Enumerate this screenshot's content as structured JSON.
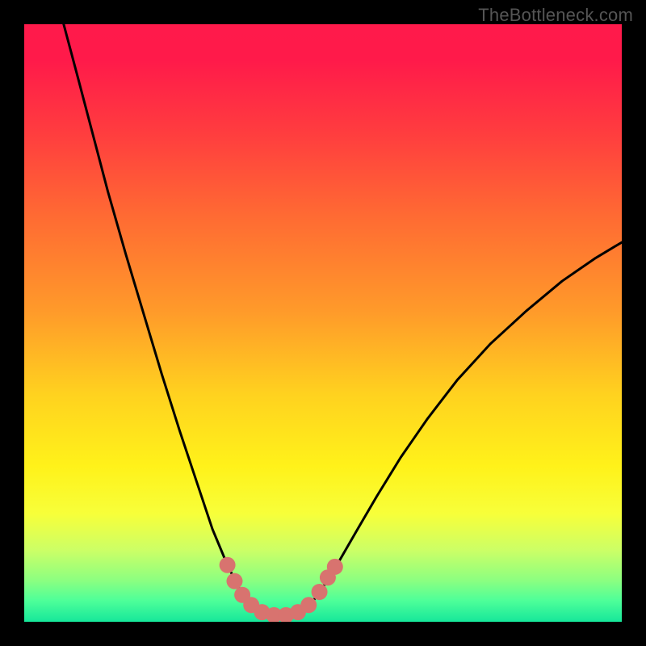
{
  "watermark": "TheBottleneck.com",
  "chart_data": {
    "type": "line",
    "title": "",
    "xlabel": "",
    "ylabel": "",
    "xlim": [
      0,
      1
    ],
    "ylim": [
      0,
      1
    ],
    "grid": false,
    "legend": false,
    "annotations": [],
    "background_gradient": {
      "stops": [
        {
          "offset": 0.0,
          "color": "#ff1a4b"
        },
        {
          "offset": 0.06,
          "color": "#ff1a4a"
        },
        {
          "offset": 0.18,
          "color": "#ff3c3f"
        },
        {
          "offset": 0.32,
          "color": "#ff6a33"
        },
        {
          "offset": 0.48,
          "color": "#ff9a2a"
        },
        {
          "offset": 0.62,
          "color": "#ffd21f"
        },
        {
          "offset": 0.74,
          "color": "#fff21a"
        },
        {
          "offset": 0.82,
          "color": "#f7ff3a"
        },
        {
          "offset": 0.88,
          "color": "#ccff66"
        },
        {
          "offset": 0.93,
          "color": "#8dff80"
        },
        {
          "offset": 0.965,
          "color": "#4dff99"
        },
        {
          "offset": 1.0,
          "color": "#16e79a"
        }
      ]
    },
    "series": [
      {
        "name": "bottleneck-curve",
        "stroke": "#000000",
        "stroke_width": 3,
        "points": [
          {
            "x": 0.066,
            "y": 1.0
          },
          {
            "x": 0.09,
            "y": 0.91
          },
          {
            "x": 0.115,
            "y": 0.815
          },
          {
            "x": 0.14,
            "y": 0.72
          },
          {
            "x": 0.17,
            "y": 0.615
          },
          {
            "x": 0.2,
            "y": 0.515
          },
          {
            "x": 0.23,
            "y": 0.415
          },
          {
            "x": 0.26,
            "y": 0.32
          },
          {
            "x": 0.29,
            "y": 0.23
          },
          {
            "x": 0.315,
            "y": 0.155
          },
          {
            "x": 0.34,
            "y": 0.095
          },
          {
            "x": 0.36,
            "y": 0.055
          },
          {
            "x": 0.38,
            "y": 0.028
          },
          {
            "x": 0.4,
            "y": 0.014
          },
          {
            "x": 0.42,
            "y": 0.01
          },
          {
            "x": 0.44,
            "y": 0.01
          },
          {
            "x": 0.46,
            "y": 0.014
          },
          {
            "x": 0.48,
            "y": 0.03
          },
          {
            "x": 0.5,
            "y": 0.058
          },
          {
            "x": 0.525,
            "y": 0.098
          },
          {
            "x": 0.555,
            "y": 0.15
          },
          {
            "x": 0.59,
            "y": 0.21
          },
          {
            "x": 0.63,
            "y": 0.275
          },
          {
            "x": 0.675,
            "y": 0.34
          },
          {
            "x": 0.725,
            "y": 0.405
          },
          {
            "x": 0.78,
            "y": 0.465
          },
          {
            "x": 0.84,
            "y": 0.52
          },
          {
            "x": 0.9,
            "y": 0.57
          },
          {
            "x": 0.955,
            "y": 0.608
          },
          {
            "x": 1.0,
            "y": 0.635
          }
        ]
      },
      {
        "name": "highlight-dots",
        "stroke": "#d8736f",
        "marker_radius": 10,
        "points": [
          {
            "x": 0.34,
            "y": 0.095
          },
          {
            "x": 0.352,
            "y": 0.068
          },
          {
            "x": 0.365,
            "y": 0.045
          },
          {
            "x": 0.38,
            "y": 0.028
          },
          {
            "x": 0.398,
            "y": 0.016
          },
          {
            "x": 0.418,
            "y": 0.011
          },
          {
            "x": 0.438,
            "y": 0.011
          },
          {
            "x": 0.458,
            "y": 0.016
          },
          {
            "x": 0.476,
            "y": 0.028
          },
          {
            "x": 0.494,
            "y": 0.05
          },
          {
            "x": 0.508,
            "y": 0.074
          },
          {
            "x": 0.52,
            "y": 0.092
          }
        ]
      }
    ]
  }
}
